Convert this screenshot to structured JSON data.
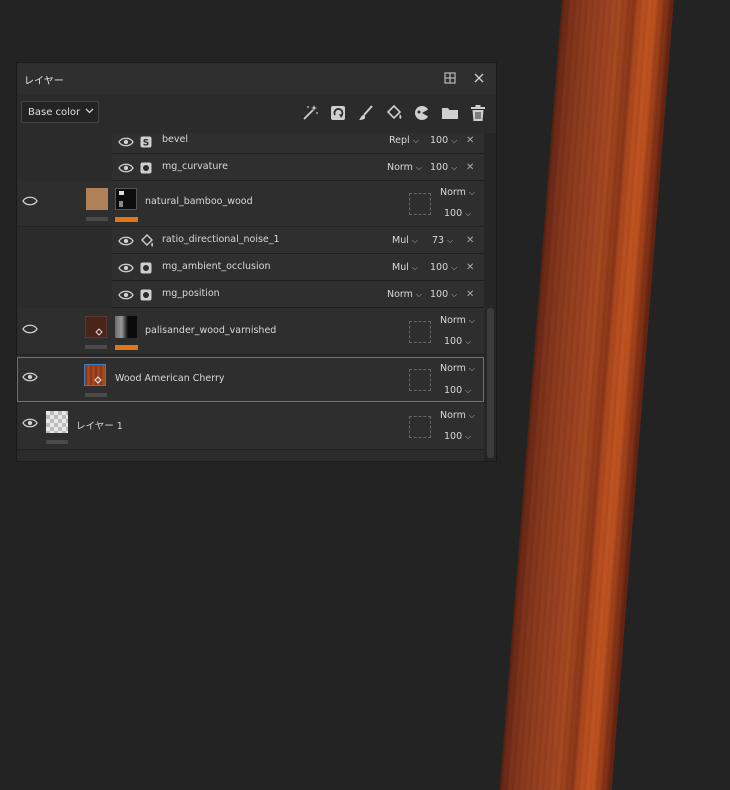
{
  "panel": {
    "title": "レイヤー",
    "channel_dropdown": {
      "selected": "Base color"
    }
  },
  "toolbar": {
    "icons": [
      "magic-wand-icon",
      "fill-refresh-icon",
      "paint-brush-icon",
      "paint-bucket-icon",
      "smart-mask-icon",
      "folder-icon",
      "trash-icon"
    ]
  },
  "rows": {
    "bevel": {
      "name": "bevel",
      "blend": "Repl",
      "opacity": "100"
    },
    "mg_curvature": {
      "name": "mg_curvature",
      "blend": "Norm",
      "opacity": "100"
    },
    "natural_bamboo_wood": {
      "name": "natural_bamboo_wood",
      "blend": "Norm",
      "opacity": "100"
    },
    "ratio_directional_noise_1": {
      "name": "ratio_directional_noise_1",
      "blend": "Mul",
      "opacity": "73"
    },
    "mg_ambient_occlusion": {
      "name": "mg_ambient_occlusion",
      "blend": "Mul",
      "opacity": "100"
    },
    "mg_position": {
      "name": "mg_position",
      "blend": "Norm",
      "opacity": "100"
    },
    "palisander_wood_varnished": {
      "name": "palisander_wood_varnished",
      "blend": "Norm",
      "opacity": "100"
    },
    "wood_american_cherry": {
      "name": "Wood American Cherry",
      "blend": "Norm",
      "opacity": "100"
    },
    "layer_1": {
      "name": "レイヤー 1",
      "blend": "Norm",
      "opacity": "100"
    }
  },
  "glyphs": {
    "close": "✕",
    "chevron": "⌵",
    "dock": "⊞"
  },
  "colors": {
    "selection_border": "#3e7bc4",
    "accent_orange": "#e2741a",
    "plank_wood": "#a4481f"
  }
}
